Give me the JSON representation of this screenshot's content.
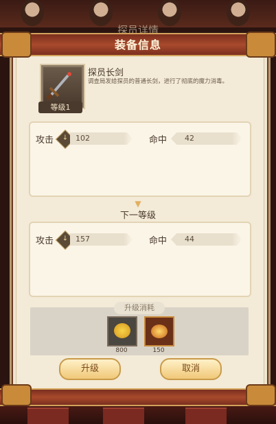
{
  "background_title": "探员详情",
  "header": {
    "title": "装备信息"
  },
  "item": {
    "name": "探员长剑",
    "description": "调查局发给探员的普通长剑，进行了彻底的魔力消毒。",
    "level_label": "等级1",
    "icon": "sword-icon"
  },
  "current_stats": {
    "attack_label": "攻击",
    "attack_value": "102",
    "hit_label": "命中",
    "hit_value": "42"
  },
  "next_level": {
    "title": "下一等级",
    "attack_label": "攻击",
    "attack_value": "157",
    "hit_label": "命中",
    "hit_value": "44"
  },
  "upgrade_cost": {
    "label": "升级消耗",
    "items": [
      {
        "icon": "gold-coin-icon",
        "count": "800"
      },
      {
        "icon": "material-pot-icon",
        "count": "150"
      }
    ]
  },
  "buttons": {
    "upgrade": "升级",
    "cancel": "取消"
  },
  "colors": {
    "accent": "#a84a2c",
    "panel": "#efe6d2",
    "button": "#f0c878"
  }
}
